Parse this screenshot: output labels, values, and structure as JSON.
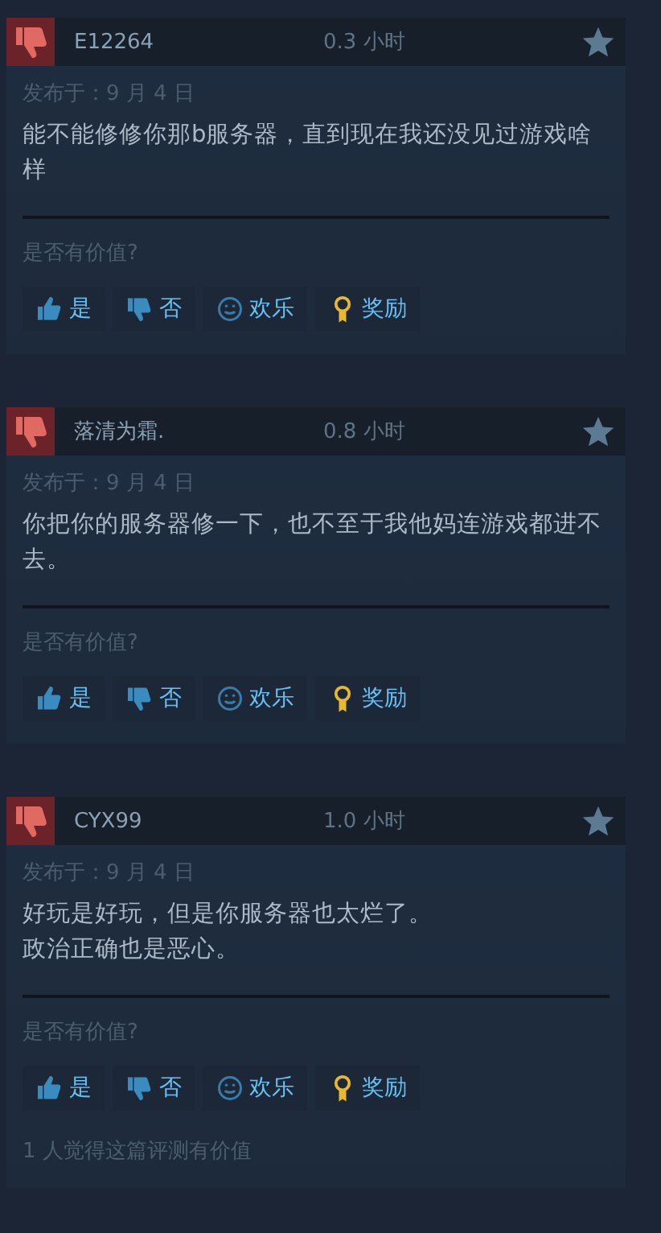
{
  "reviews": [
    {
      "recommended": false,
      "author": "E12264",
      "hours": "0.3 小时",
      "date": "发布于：9 月 4 日",
      "body": [
        "能不能修修你那b服务器，直到现在我还没见过游戏啥样"
      ],
      "question": "是否有价值?",
      "actions": [
        "是",
        "否",
        "欢乐",
        "奖励"
      ]
    },
    {
      "recommended": false,
      "author": "落清为霜.",
      "hours": "0.8 小时",
      "date": "发布于：9 月 4 日",
      "body": [
        "你把你的服务器修一下，也不至于我他妈连游戏都进不去。"
      ],
      "question": "是否有价值?",
      "actions": [
        "是",
        "否",
        "欢乐",
        "奖励"
      ]
    },
    {
      "recommended": false,
      "author": "CYX99",
      "hours": "1.0 小时",
      "date": "发布于：9 月 4 日",
      "body": [
        "好玩是好玩，但是你服务器也太烂了。",
        "政治正确也是恶心。"
      ],
      "question": "是否有价值?",
      "actions": [
        "是",
        "否",
        "欢乐",
        "奖励"
      ],
      "helpful_note": "1 人觉得这篇评测有价值"
    }
  ]
}
